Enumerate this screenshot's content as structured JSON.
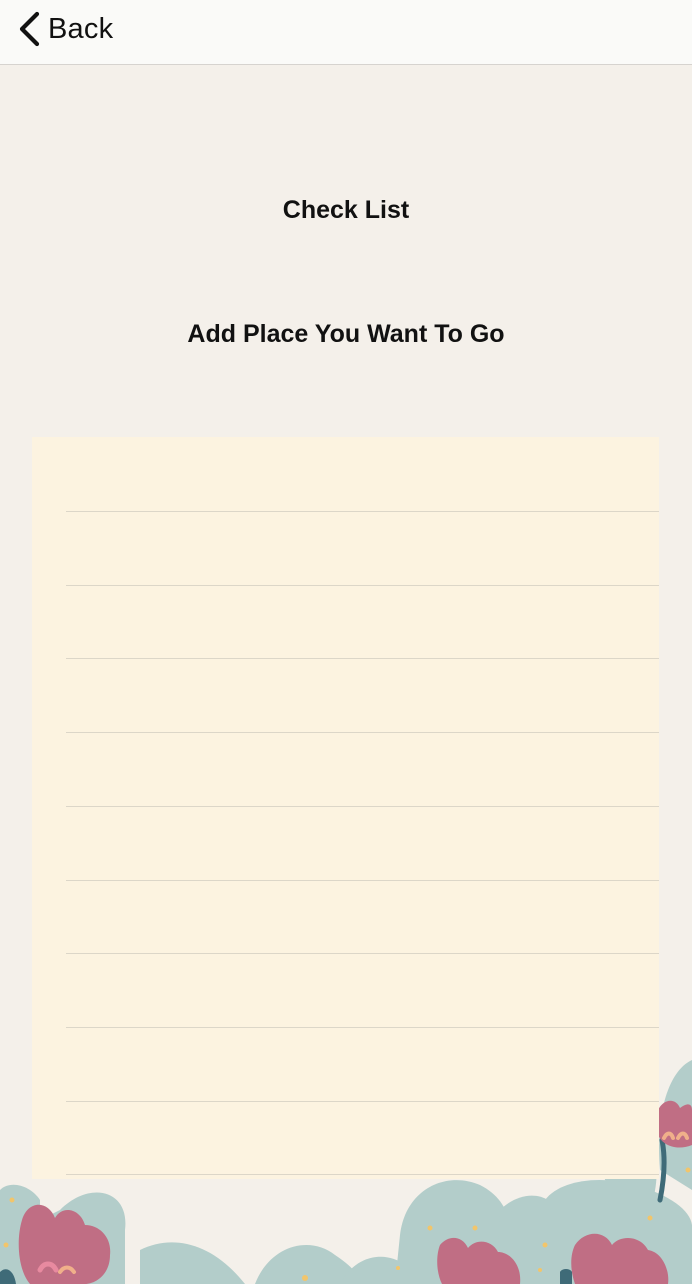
{
  "navbar": {
    "back_label": "Back"
  },
  "page": {
    "title": "Check List",
    "subtitle": "Add Place You Want To Go"
  },
  "checklist": {
    "items": [
      "",
      "",
      "",
      "",
      "",
      "",
      "",
      "",
      "",
      ""
    ]
  },
  "colors": {
    "background": "#f4f0ea",
    "navbar": "#fafaf8",
    "paper": "#fcf3e0",
    "rule_line": "#dcd6c8",
    "leaf": "#b3cdca",
    "flower": "#c06e84",
    "accent_dot": "#f2c56b"
  },
  "icons": {
    "back": "chevron-left-icon"
  }
}
